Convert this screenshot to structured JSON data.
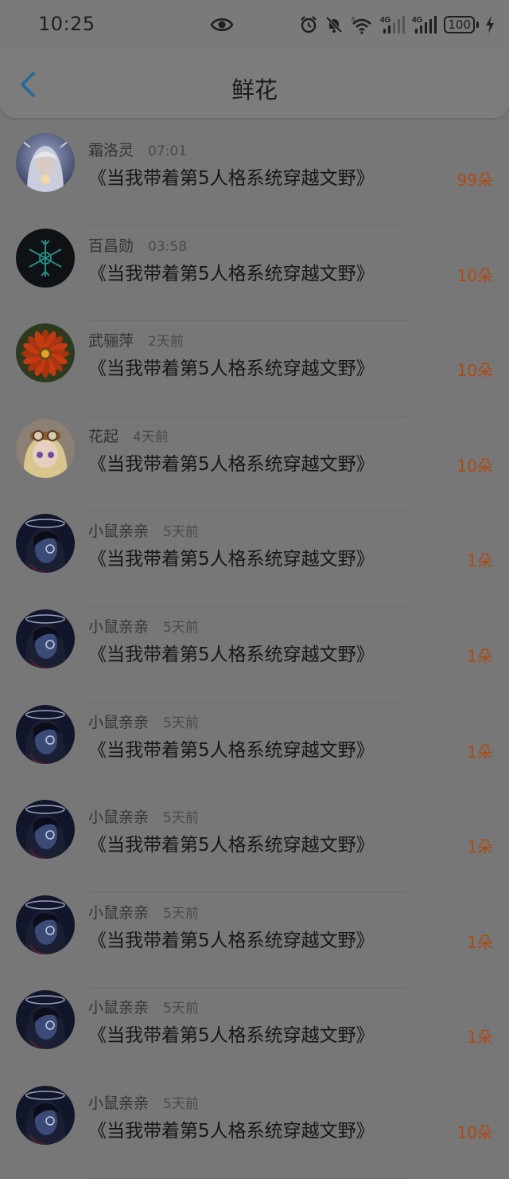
{
  "status_bar": {
    "time": "10:25",
    "battery": "100"
  },
  "header": {
    "title": "鲜花"
  },
  "items": [
    {
      "username": "霜洛灵",
      "time": "07:01",
      "book": "《当我带着第5人格系统穿越文野》",
      "count": "99朵",
      "avatar": "ice-girl"
    },
    {
      "username": "百昌勋",
      "time": "03:58",
      "book": "《当我带着第5人格系统穿越文野》",
      "count": "10朵",
      "avatar": "snowflake"
    },
    {
      "username": "武骊萍",
      "time": "2天前",
      "book": "《当我带着第5人格系统穿越文野》",
      "count": "10朵",
      "avatar": "flower"
    },
    {
      "username": "花起",
      "time": "4天前",
      "book": "《当我带着第5人格系统穿越文野》",
      "count": "10朵",
      "avatar": "blonde-girl"
    },
    {
      "username": "小鼠亲亲",
      "time": "5天前",
      "book": "《当我带着第5人格系统穿越文野》",
      "count": "1朵",
      "avatar": "dark-character"
    },
    {
      "username": "小鼠亲亲",
      "time": "5天前",
      "book": "《当我带着第5人格系统穿越文野》",
      "count": "1朵",
      "avatar": "dark-character"
    },
    {
      "username": "小鼠亲亲",
      "time": "5天前",
      "book": "《当我带着第5人格系统穿越文野》",
      "count": "1朵",
      "avatar": "dark-character"
    },
    {
      "username": "小鼠亲亲",
      "time": "5天前",
      "book": "《当我带着第5人格系统穿越文野》",
      "count": "1朵",
      "avatar": "dark-character"
    },
    {
      "username": "小鼠亲亲",
      "time": "5天前",
      "book": "《当我带着第5人格系统穿越文野》",
      "count": "1朵",
      "avatar": "dark-character"
    },
    {
      "username": "小鼠亲亲",
      "time": "5天前",
      "book": "《当我带着第5人格系统穿越文野》",
      "count": "1朵",
      "avatar": "dark-character"
    },
    {
      "username": "小鼠亲亲",
      "time": "5天前",
      "book": "《当我带着第5人格系统穿越文野》",
      "count": "10朵",
      "avatar": "dark-character"
    }
  ],
  "icons": {
    "status": [
      "eye-icon",
      "alarm-icon",
      "mute-icon",
      "wifi-icon",
      "signal-4g-icon",
      "battery-icon",
      "charging-icon"
    ],
    "header": [
      "back-arrow-icon"
    ]
  },
  "colors": {
    "accent_back": "#1f6a9a",
    "count": "#ad4a12"
  }
}
